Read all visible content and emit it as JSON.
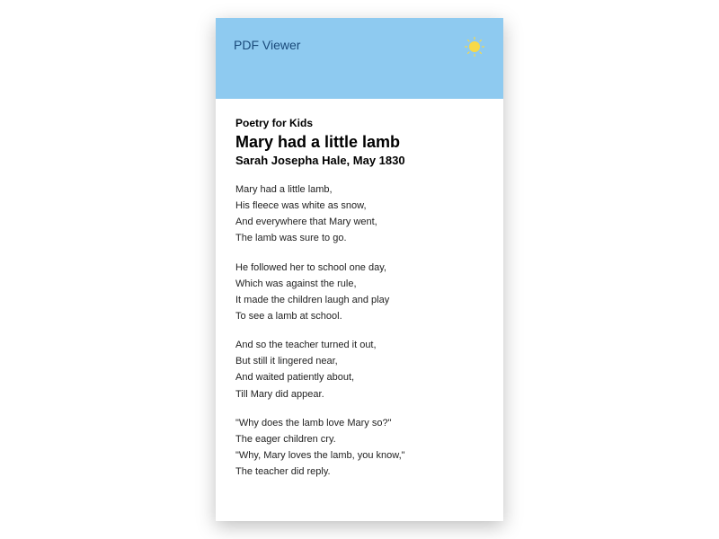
{
  "header": {
    "app_title": "PDF Viewer"
  },
  "document": {
    "category": "Poetry for Kids",
    "title": "Mary had a little lamb",
    "author": "Sarah Josepha Hale, May 1830",
    "stanzas": [
      [
        "Mary had a little lamb,",
        "His fleece was white as snow,",
        "And everywhere that Mary went,",
        "The lamb was sure to go."
      ],
      [
        "He followed her to school one day,",
        "Which was against the rule,",
        "It made the children laugh and play",
        "To see a lamb at school."
      ],
      [
        "And so the teacher turned it out,",
        "But still it lingered near,",
        "And waited patiently about,",
        "Till Mary did appear."
      ],
      [
        "\"Why does the lamb love Mary so?\"",
        "The eager children cry.",
        "\"Why, Mary loves the lamb, you know,\"",
        "The teacher did reply."
      ]
    ]
  }
}
